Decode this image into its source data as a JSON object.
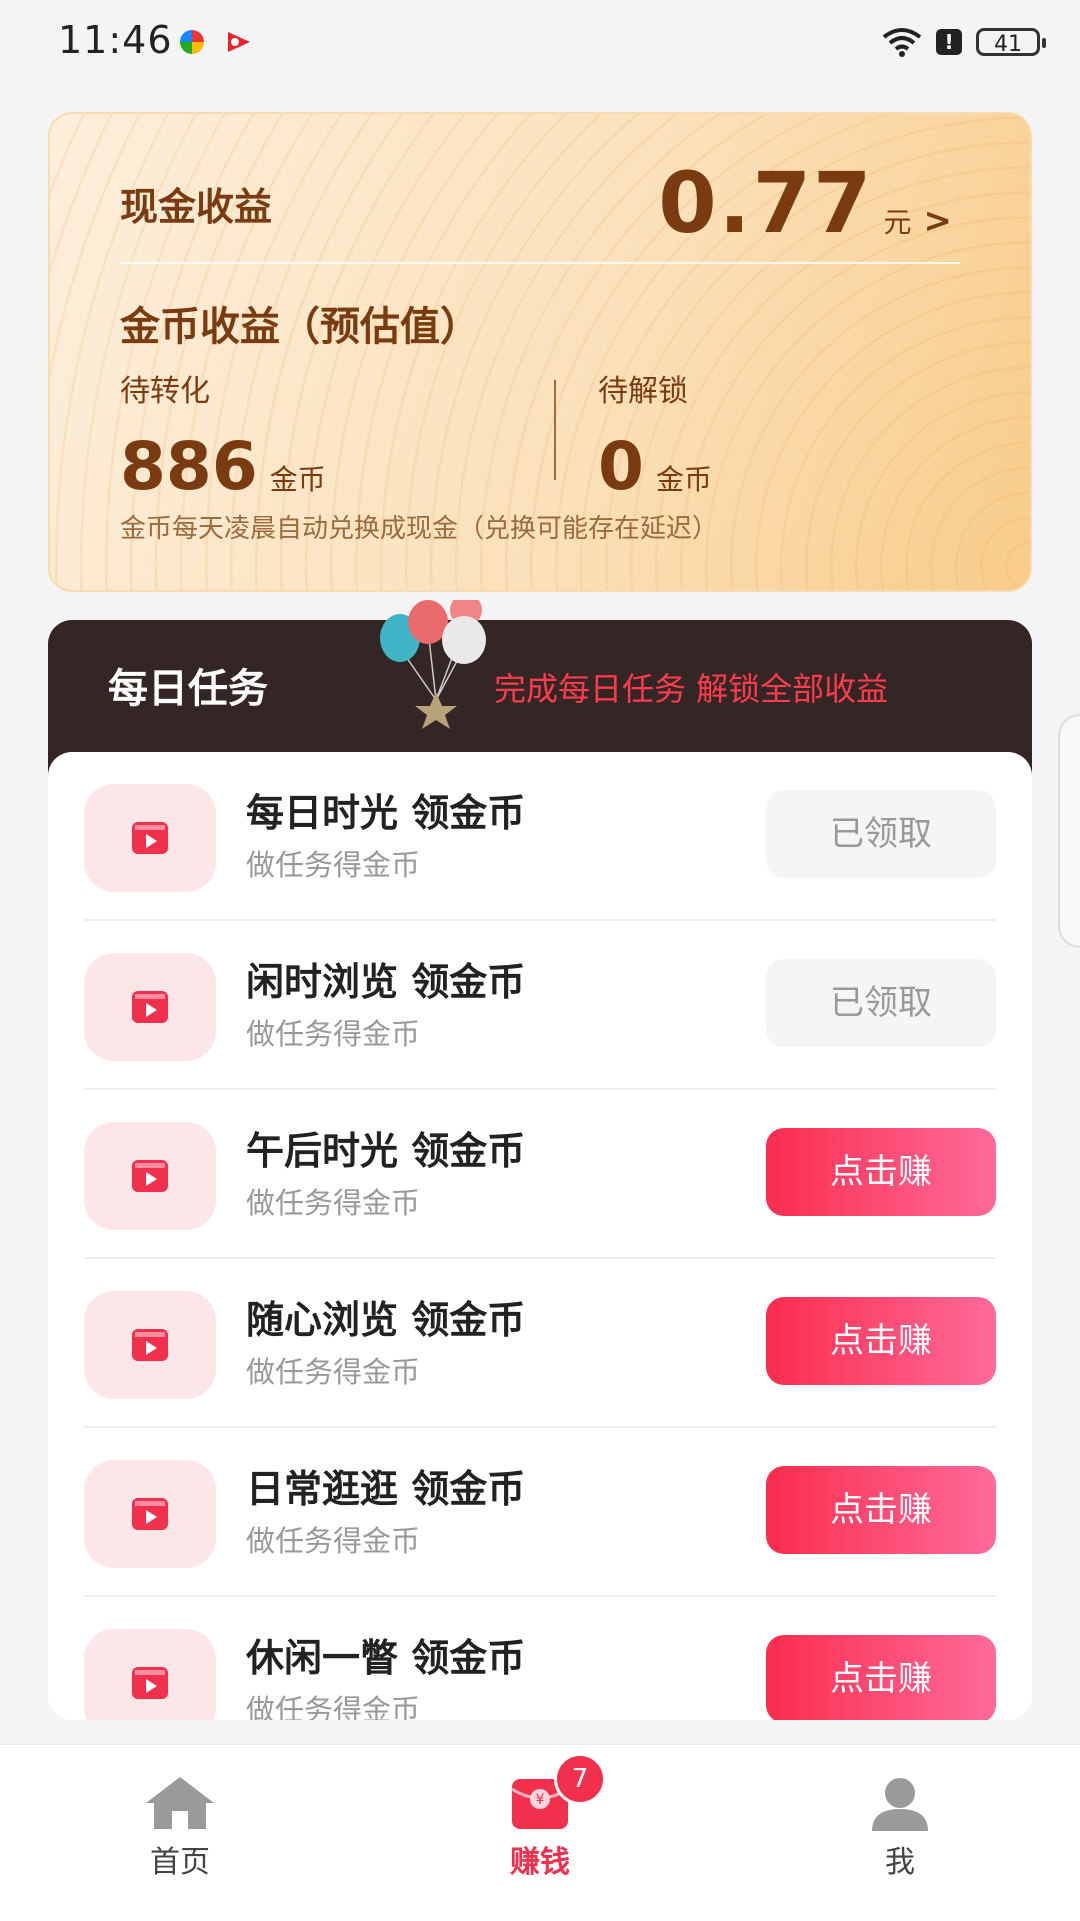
{
  "status_bar": {
    "time": "11:46",
    "battery": "41"
  },
  "earnings": {
    "cash_label": "现金收益",
    "cash_value": "0.77",
    "cash_unit": "元",
    "coin_title": "金币收益（预估值）",
    "pending_convert_label": "待转化",
    "pending_convert_value": "886",
    "pending_unlock_label": "待解锁",
    "pending_unlock_value": "0",
    "coin_unit": "金币",
    "note": "金币每天凌晨自动兑换成现金（兑换可能存在延迟）"
  },
  "tasks": {
    "title": "每日任务",
    "promo": "完成每日任务 解锁全部收益",
    "items": [
      {
        "name": "每日时光 领金币",
        "sub": "做任务得金币",
        "button": "已领取",
        "state": "done"
      },
      {
        "name": "闲时浏览 领金币",
        "sub": "做任务得金币",
        "button": "已领取",
        "state": "done"
      },
      {
        "name": "午后时光 领金币",
        "sub": "做任务得金币",
        "button": "点击赚",
        "state": "earn"
      },
      {
        "name": "随心浏览 领金币",
        "sub": "做任务得金币",
        "button": "点击赚",
        "state": "earn"
      },
      {
        "name": "日常逛逛 领金币",
        "sub": "做任务得金币",
        "button": "点击赚",
        "state": "earn"
      },
      {
        "name": "休闲一瞥 领金币",
        "sub": "做任务得金币",
        "button": "点击赚",
        "state": "earn"
      }
    ]
  },
  "bottom_nav": {
    "home": "首页",
    "earn": "赚钱",
    "earn_badge": "7",
    "me": "我"
  },
  "icons": {
    "chevron": "chevron-right-icon",
    "task_icon": "video-play-icon",
    "home": "home-icon",
    "earn": "red-envelope-icon",
    "me": "person-icon"
  },
  "colors": {
    "accent": "#f0304c",
    "earn_button_start": "#fa2d4e",
    "earn_button_end": "#ff6a9a",
    "card_text": "#7a3b10",
    "tasks_header_bg": "#332625"
  }
}
